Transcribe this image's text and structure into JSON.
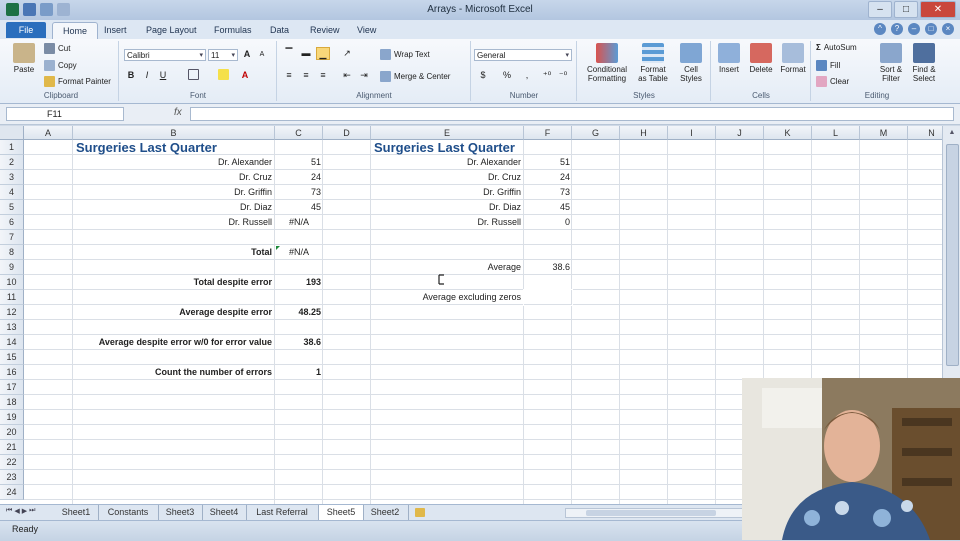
{
  "window": {
    "title": "Arrays - Microsoft Excel"
  },
  "ribbon_tabs": [
    "File",
    "Home",
    "Insert",
    "Page Layout",
    "Formulas",
    "Data",
    "Review",
    "View"
  ],
  "clipboard": {
    "paste": "Paste",
    "cut": "Cut",
    "copy": "Copy",
    "format_painter": "Format Painter",
    "label": "Clipboard"
  },
  "font": {
    "name": "Calibri",
    "size": "11",
    "label": "Font",
    "bold": "B",
    "italic": "I",
    "underline": "U",
    "grow": "A",
    "shrink": "A"
  },
  "alignment": {
    "wrap_text": "Wrap Text",
    "merge_center": "Merge & Center",
    "label": "Alignment"
  },
  "number": {
    "format": "General",
    "currency": "$",
    "percent": "%",
    "comma": ",",
    "label": "Number"
  },
  "styles": {
    "conditional": [
      "Conditional",
      "Formatting"
    ],
    "format_table": [
      "Format",
      "as Table"
    ],
    "cell_styles": [
      "Cell",
      "Styles"
    ],
    "label": "Styles"
  },
  "cells": {
    "insert": "Insert",
    "delete": "Delete",
    "format": "Format",
    "label": "Cells"
  },
  "editing": {
    "autosum": "AutoSum",
    "fill": "Fill",
    "clear": "Clear",
    "sort": [
      "Sort &",
      "Filter"
    ],
    "find": [
      "Find &",
      "Select"
    ],
    "label": "Editing"
  },
  "formula_bar": {
    "name_box": "F11",
    "fx": "fx",
    "content": ""
  },
  "columns": [
    "A",
    "B",
    "C",
    "D",
    "E",
    "F",
    "G",
    "H",
    "I",
    "J",
    "K",
    "L",
    "M",
    "N"
  ],
  "rows": [
    "1",
    "2",
    "3",
    "4",
    "5",
    "6",
    "7",
    "8",
    "9",
    "10",
    "11",
    "12",
    "13",
    "14",
    "15",
    "16",
    "17",
    "18",
    "19",
    "20",
    "21",
    "22",
    "23",
    "24"
  ],
  "left_table": {
    "title": "Surgeries Last Quarter",
    "doctors": [
      {
        "name": "Dr. Alexander",
        "value": "51"
      },
      {
        "name": "Dr. Cruz",
        "value": "24"
      },
      {
        "name": "Dr. Griffin",
        "value": "73"
      },
      {
        "name": "Dr. Diaz",
        "value": "45"
      },
      {
        "name": "Dr. Russell",
        "value": "#N/A"
      }
    ],
    "total_label": "Total",
    "total_value": "#N/A",
    "total_despite_label": "Total despite error",
    "total_despite_value": "193",
    "avg_despite_label": "Average despite error",
    "avg_despite_value": "48.25",
    "avg_w0_label": "Average despite error w/0 for error value",
    "avg_w0_value": "38.6",
    "count_errors_label": "Count the number of errors",
    "count_errors_value": "1"
  },
  "right_table": {
    "title": "Surgeries Last Quarter",
    "doctors": [
      {
        "name": "Dr. Alexander",
        "value": "51"
      },
      {
        "name": "Dr. Cruz",
        "value": "24"
      },
      {
        "name": "Dr. Griffin",
        "value": "73"
      },
      {
        "name": "Dr. Diaz",
        "value": "45"
      },
      {
        "name": "Dr. Russell",
        "value": "0"
      }
    ],
    "average_label": "Average",
    "average_value": "38.6",
    "avg_excl_label": "Average excluding zeros"
  },
  "sheet_tabs": [
    "Sheet1",
    "Constants",
    "Sheet3",
    "Sheet4",
    "Last Referral",
    "Sheet5",
    "Sheet2"
  ],
  "active_sheet": "Sheet5",
  "status": {
    "ready": "Ready"
  }
}
